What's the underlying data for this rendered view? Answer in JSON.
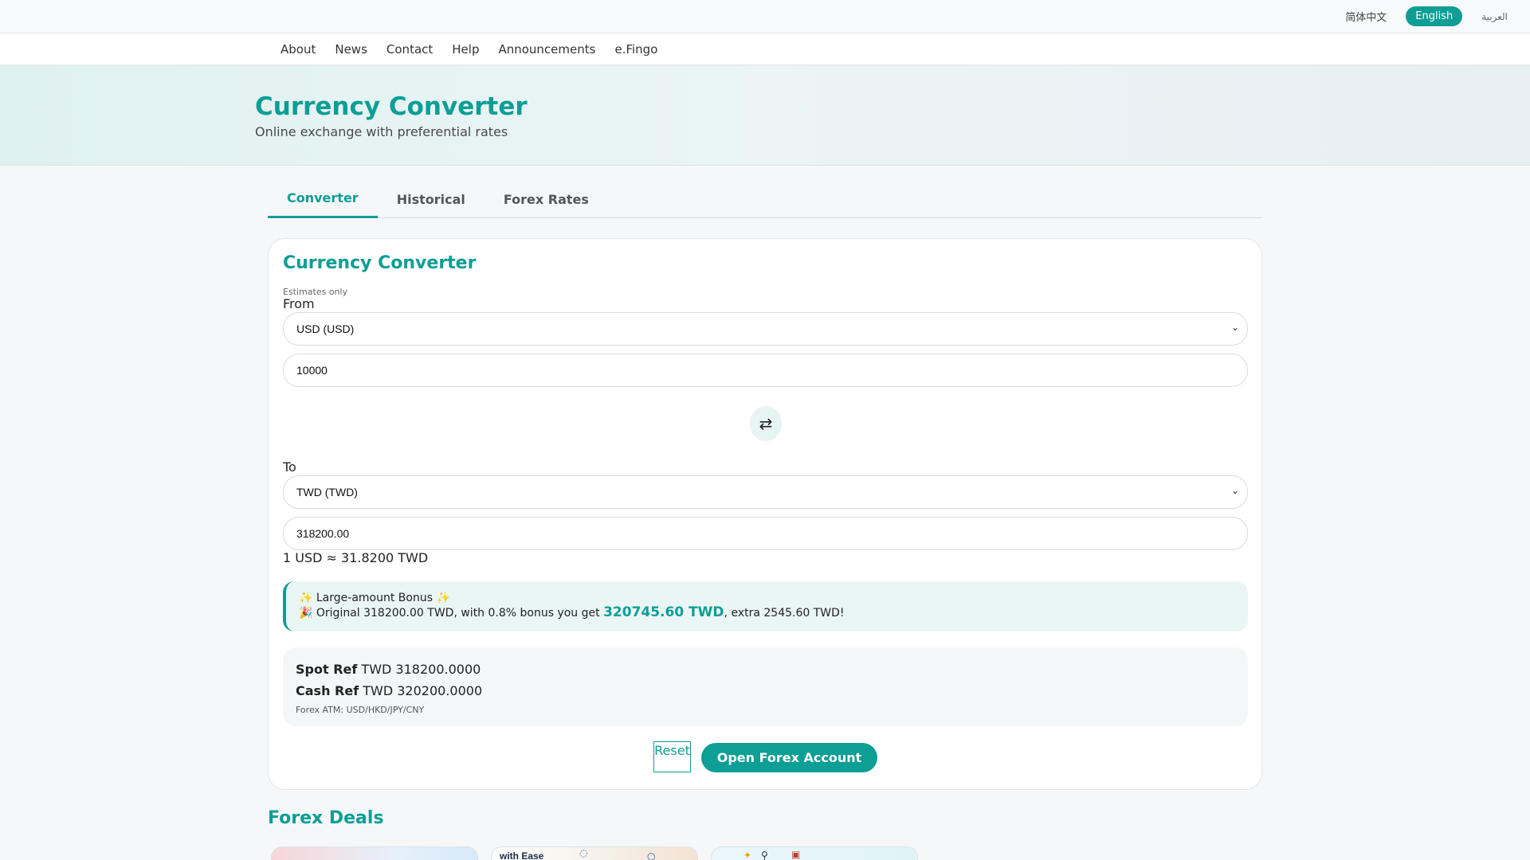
{
  "languages": [
    {
      "label": "简体中文"
    },
    {
      "label": "English"
    },
    {
      "label": "العربية"
    }
  ],
  "nav": [
    "About",
    "News",
    "Contact",
    "Help",
    "Announcements",
    "e.Fingo"
  ],
  "hero": {
    "title": "Currency Converter",
    "subtitle": "Online exchange with preferential rates"
  },
  "tabs": [
    "Converter",
    "Historical",
    "Forex Rates"
  ],
  "converter": {
    "title": "Currency Converter",
    "note": "Estimates only",
    "from_label": "From",
    "from_currency": "USD (USD)",
    "from_amount": "10000",
    "to_label": "To",
    "to_currency": "TWD (TWD)",
    "to_amount": "318200.00",
    "rate": "1 USD ≈ 31.8200 TWD",
    "swap_icon": "⇄"
  },
  "bonus": {
    "heading": "✨ Large-amount Bonus ✨",
    "prefix": "🎉 Original 318200.00 TWD, with 0.8% bonus you get",
    "amount": "320745.60 TWD",
    "suffix": ", extra 2545.60 TWD!"
  },
  "refs": {
    "spot_label": "Spot Ref",
    "spot_value": "TWD 318200.0000",
    "cash_label": "Cash Ref",
    "cash_value": "TWD 320200.0000",
    "atm": "Forex ATM: USD/HKD/JPY/CNY"
  },
  "buttons": {
    "reset": "Reset",
    "open_account": "Open Forex Account"
  },
  "deals": {
    "title": "Forex Deals",
    "deal2_text": "with Ease"
  },
  "colors": {
    "accent": "#0d9e95",
    "bonus_bg": "#eaf6f4"
  }
}
